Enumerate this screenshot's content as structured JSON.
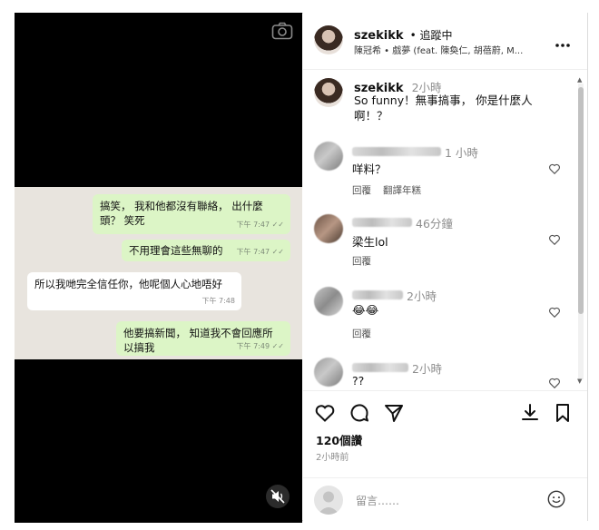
{
  "post": {
    "username": "szekikk",
    "follow_status": "• 追蹤中",
    "audio": "陳冠希 • 戲夢 (feat. 陳奐仁, 胡蓓蔚, M...",
    "caption_time": "2小時",
    "caption": "So funny！無事搞事， 你是什麼人啊！？",
    "likes": "120個讚",
    "posted_ago": "2小時前",
    "comment_placeholder": "留言……"
  },
  "chat": [
    {
      "side": "out",
      "text": "搞笑， 我和他都沒有聯絡， 出什麼頭？ 笑死",
      "time": "下午 7:47 ✓✓"
    },
    {
      "side": "out",
      "text": "不用理會這些無聊的",
      "time": "下午 7:47 ✓✓"
    },
    {
      "side": "in",
      "text": "所以我哋完全信任你，他呢個人心地唔好",
      "time": "下午 7:48"
    },
    {
      "side": "out",
      "text": "他要搞新聞， 知道我不會回應所以搞我",
      "time": "下午 7:49 ✓✓"
    }
  ],
  "comments": [
    {
      "time": "1 小時",
      "text": "咩料？",
      "actions": [
        "回覆",
        "翻譯年糕"
      ]
    },
    {
      "time": "46分鐘",
      "text": "梁生lol",
      "actions": [
        "回覆"
      ]
    },
    {
      "time": "2小時",
      "text": "😂😂",
      "actions": [
        "回覆"
      ]
    },
    {
      "time": "2小時",
      "text": "??",
      "actions": []
    }
  ],
  "menu_icon": "more-horizontal-icon",
  "media_icons": [
    "camera-icon",
    "mute-icon"
  ]
}
